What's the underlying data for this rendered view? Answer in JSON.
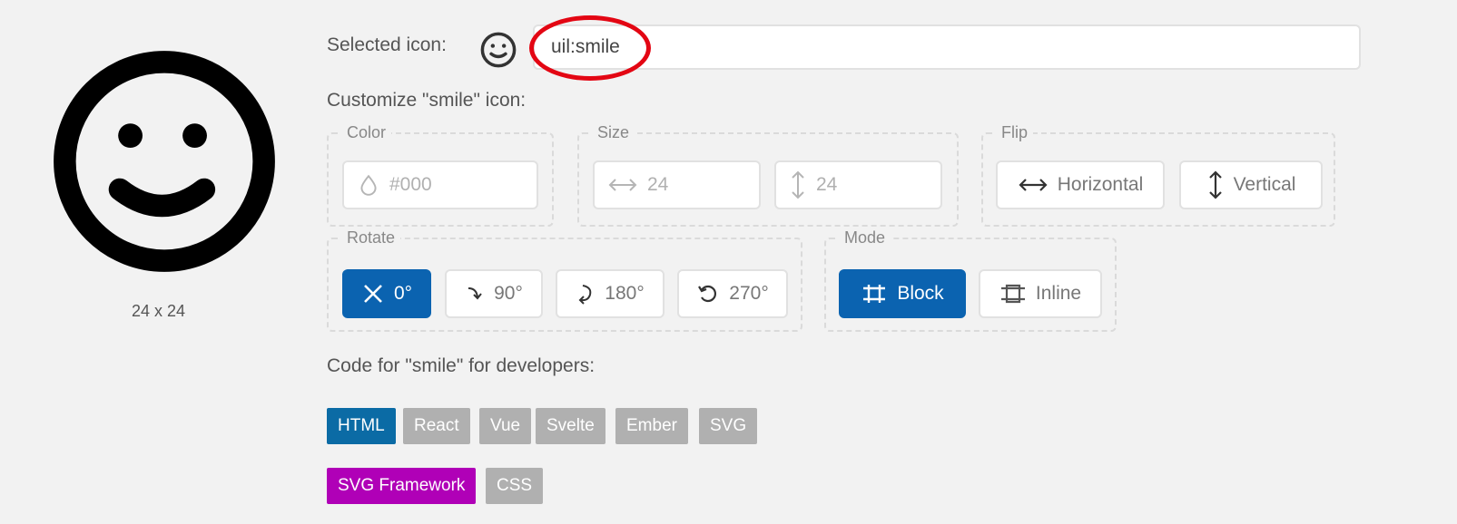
{
  "preview": {
    "size_text": "24 x 24",
    "icon": "smile-icon"
  },
  "selected": {
    "label": "Selected icon:",
    "icon": "smile-icon",
    "input_value": "uil:smile"
  },
  "customize": {
    "title": "Customize \"smile\" icon:"
  },
  "color_group": {
    "legend": "Color",
    "placeholder": "#000",
    "icon": "droplet-icon"
  },
  "size_group": {
    "legend": "Size",
    "width_placeholder": "24",
    "height_placeholder": "24",
    "width_icon": "horizontal-arrows-icon",
    "height_icon": "vertical-arrows-icon"
  },
  "flip_group": {
    "legend": "Flip",
    "horizontal": "Horizontal",
    "vertical": "Vertical"
  },
  "rotate_group": {
    "legend": "Rotate",
    "options": [
      {
        "label": "0°",
        "icon": "close-icon",
        "active": true
      },
      {
        "label": "90°",
        "icon": "rotate-90-icon",
        "active": false
      },
      {
        "label": "180°",
        "icon": "rotate-180-icon",
        "active": false
      },
      {
        "label": "270°",
        "icon": "rotate-270-icon",
        "active": false
      }
    ]
  },
  "mode_group": {
    "legend": "Mode",
    "block": "Block",
    "inline": "Inline",
    "active": "Block"
  },
  "code": {
    "title": "Code for \"smile\" for developers:",
    "tabs_row1": [
      "HTML",
      "React",
      "Vue",
      "Svelte",
      "Ember",
      "SVG"
    ],
    "tabs_row2": [
      "SVG Framework",
      "CSS"
    ],
    "active_row1": "HTML",
    "active_row2": "SVG Framework"
  },
  "colors": {
    "accent_blue": "#0b63b0",
    "tab_blue": "#0b6ba5",
    "tab_purple": "#b000b7",
    "highlight_red": "#e30613"
  }
}
